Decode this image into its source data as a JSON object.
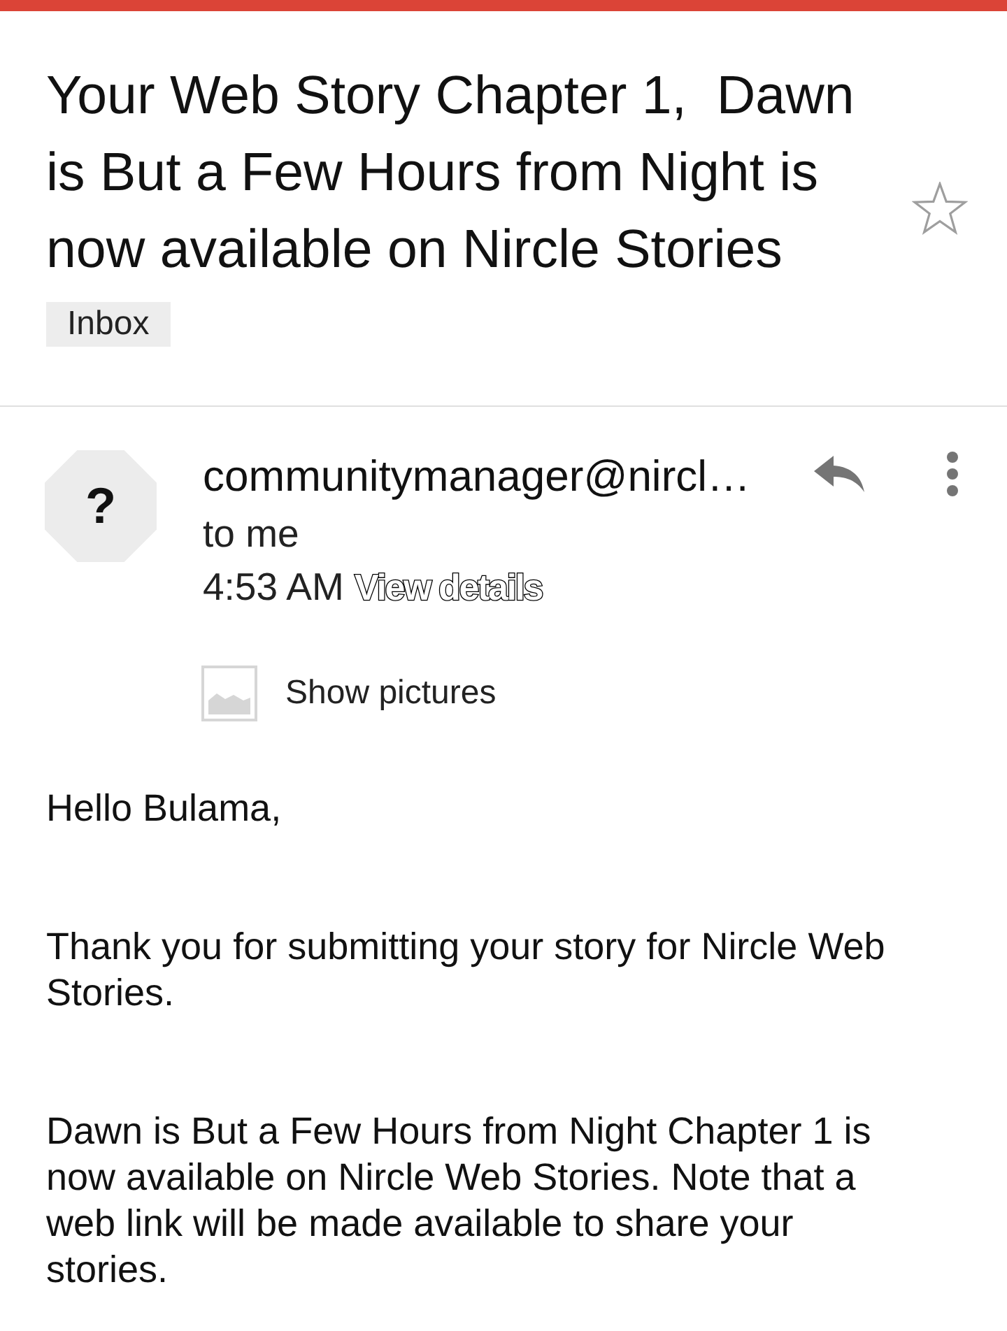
{
  "subject": {
    "title": "Your Web Story Chapter 1,  Dawn is But a Few Hours from Night is now available on Nircle Stories",
    "starred": false,
    "label": "Inbox"
  },
  "message": {
    "avatar": "?",
    "sender": "communitymanager@nircl…",
    "recipient": "to me",
    "time": "4:53 AM",
    "details_link": "View details"
  },
  "images_notice": {
    "label": "Show pictures"
  },
  "body": [
    "Hello Bulama,",
    "Thank you for submitting your story for Nircle Web Stories.",
    "Dawn is But a Few Hours from Night Chapter 1 is now available on Nircle Web Stories. Note that a web link will be made available to share your stories."
  ]
}
